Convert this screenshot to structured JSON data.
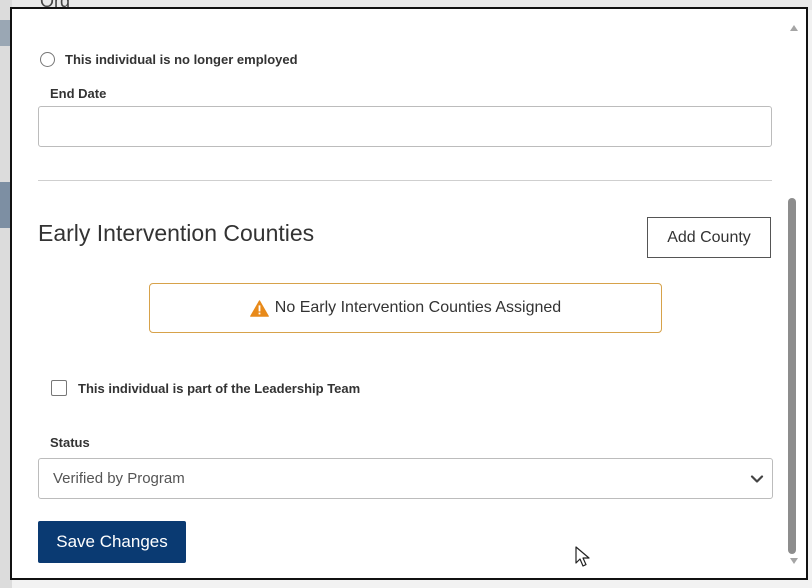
{
  "background": {
    "top_text": "Org"
  },
  "employment": {
    "no_longer_employed_label": "This individual is no longer employed"
  },
  "end_date": {
    "label": "End Date",
    "value": ""
  },
  "counties": {
    "title": "Early Intervention Counties",
    "add_button_label": "Add County",
    "alert_text": "No Early Intervention Counties Assigned",
    "alert_icon": "warning-icon"
  },
  "leadership": {
    "checkbox_label": "This individual is part of the Leadership Team",
    "checked": false
  },
  "status": {
    "label": "Status",
    "selected": "Verified by Program"
  },
  "actions": {
    "save_label": "Save Changes"
  },
  "colors": {
    "primary": "#0a3a72",
    "alert_border": "#d7a24a",
    "warning": "#e88a1a"
  }
}
